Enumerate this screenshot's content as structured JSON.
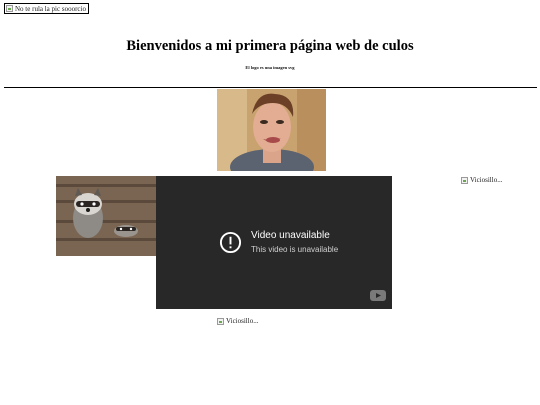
{
  "top_image": {
    "alt": "No te rula la pic sooorcio"
  },
  "heading": "Bienvenidos a mi primera página web de culos",
  "subnote": "El logo es una imagen svg",
  "photo_man": {
    "label": ""
  },
  "video_player": {
    "title": "Video unavailable",
    "message": "This video is unavailable",
    "icons": [
      "alert-icon",
      "youtube-logo-icon"
    ],
    "background": "#282828"
  },
  "right_image": {
    "alt": "Viciosillo..."
  },
  "bottom_image": {
    "alt": "Viciosillo..."
  }
}
